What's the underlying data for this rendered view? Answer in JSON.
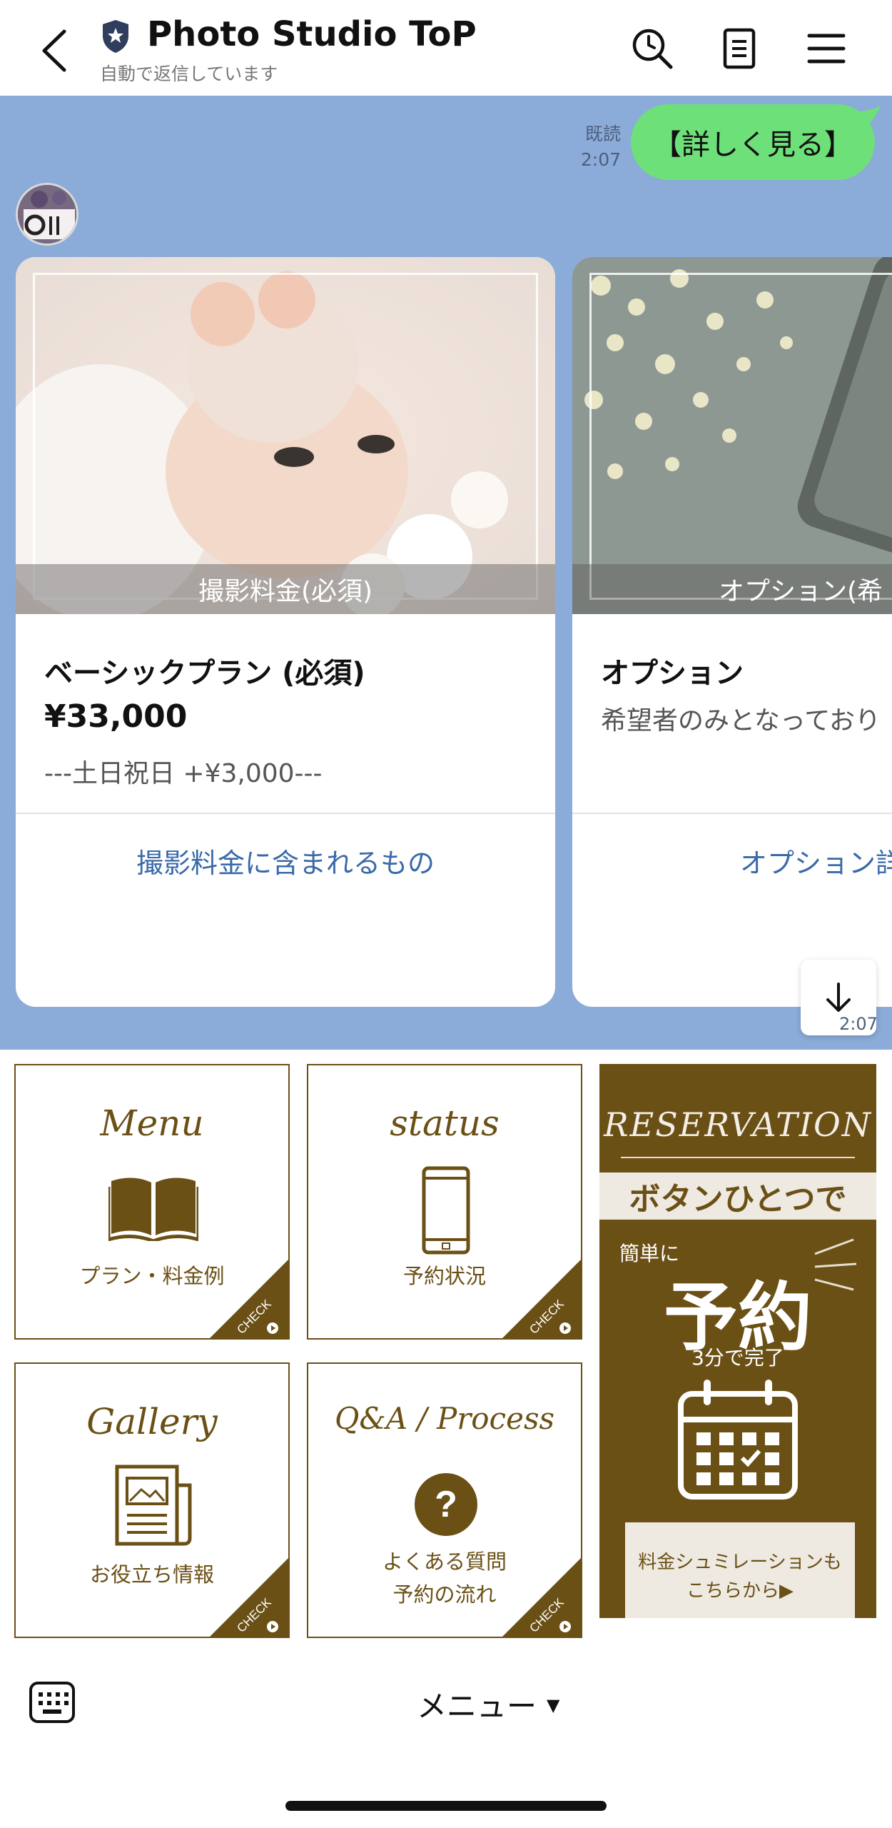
{
  "header": {
    "title": "Photo Studio ToP",
    "subtitle": "自動で返信しています",
    "back_icon": "chevron-left-icon",
    "actions": [
      "search-icon",
      "notes-icon",
      "menu-icon"
    ]
  },
  "chat": {
    "background": "#8babd8",
    "outgoing": {
      "read_label": "既読",
      "time": "2:07",
      "text": "【詳しく見る】",
      "color": "#6ee07a"
    },
    "cards": [
      {
        "image_label": "撮影料金(必須)",
        "title": "ベーシックプラン (必須)",
        "price": "¥33,000",
        "note": "---土日祝日 +¥3,000---",
        "link": "撮影料金に含まれるもの"
      },
      {
        "image_label": "オプション(希",
        "title": "オプション",
        "description": "希望者のみとなっており",
        "link": "オプション詳"
      }
    ],
    "timestamp": "2:07",
    "scroll_icon": "arrow-down-icon"
  },
  "richmenu": {
    "accent": "#6b5016",
    "tiles": [
      {
        "script": "Menu",
        "label": "プラン・料金例",
        "icon": "book-icon",
        "badge": "CHECK"
      },
      {
        "script": "status",
        "label": "予約状況",
        "icon": "smartphone-icon",
        "badge": "CHECK"
      },
      {
        "script": "Gallery",
        "label": "お役立ち情報",
        "icon": "newspaper-icon",
        "badge": "CHECK"
      },
      {
        "script": "Q&A / Process",
        "label1": "よくある質問",
        "label2": "予約の流れ",
        "icon": "question-icon",
        "badge": "CHECK"
      }
    ],
    "reservation": {
      "script": "RESERVATION",
      "band": "ボタンひとつで",
      "small": "簡単に",
      "big": "予約",
      "sub": "3分で完了",
      "icon": "calendar-icon",
      "box_line1": "料金シュミレーションも",
      "box_line2": "こちらから▶"
    }
  },
  "bottom": {
    "keyboard_icon": "keyboard-icon",
    "menu_label": "メニュー",
    "caret": "▼"
  }
}
